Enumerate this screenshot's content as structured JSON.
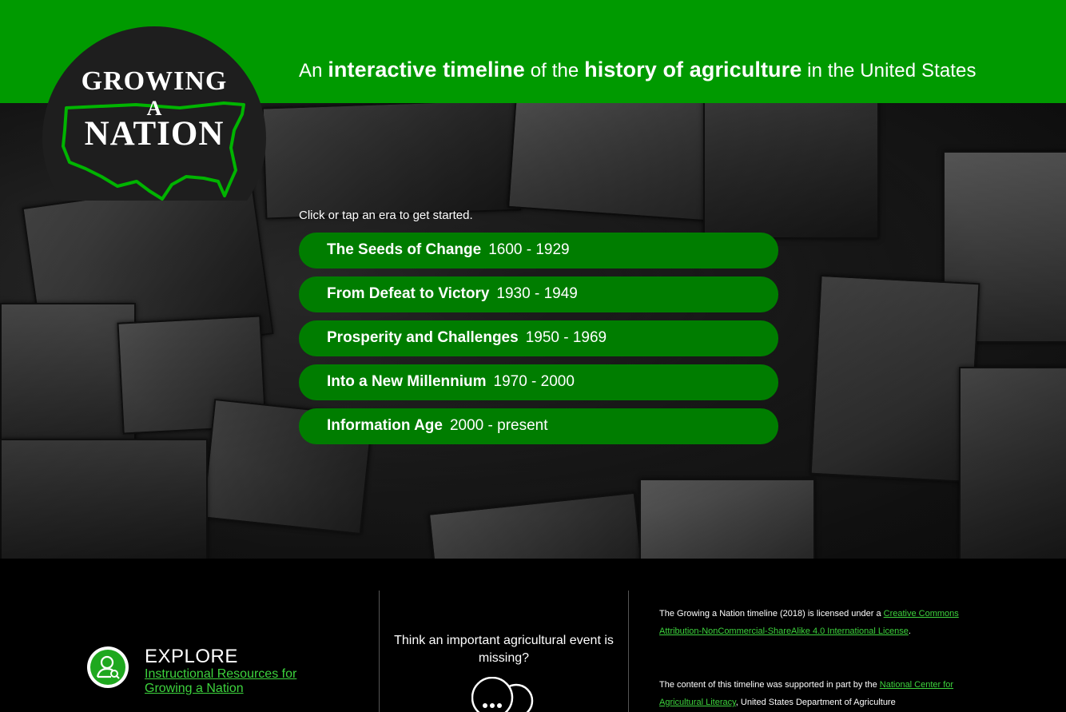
{
  "logo": {
    "line1": "GROWING",
    "line2": "A",
    "line3": "NATION"
  },
  "header": {
    "tagline_part1": "An ",
    "tagline_strong1": "interactive timeline",
    "tagline_part2": " of the ",
    "tagline_strong2": "history of agriculture",
    "tagline_part3": " in the United States"
  },
  "main": {
    "prompt": "Click or tap an era to get started.",
    "eras": [
      {
        "name": "The Seeds of Change",
        "years": "1600 - 1929"
      },
      {
        "name": "From Defeat to Victory",
        "years": "1930 - 1949"
      },
      {
        "name": "Prosperity and Challenges",
        "years": "1950 - 1969"
      },
      {
        "name": "Into a New Millennium",
        "years": "1970 - 2000"
      },
      {
        "name": "Information Age",
        "years": "2000 - present"
      }
    ]
  },
  "footer": {
    "explore_title": "EXPLORE",
    "explore_link": "Instructional Resources for Growing a Nation",
    "missing_text": "Think an important agricultural event is missing?",
    "license_prefix": "The Growing a Nation timeline (2018) is licensed under a ",
    "license_link": "Creative Commons Attribution-NonCommercial-ShareAlike 4.0 International License",
    "license_suffix": ".",
    "support_prefix": "The content of this timeline was supported in part by the ",
    "support_link": "National Center for Agricultural Literacy",
    "support_suffix": ", United States Department of Agriculture"
  },
  "colors": {
    "header_green": "#009a00",
    "era_button": "#007d00",
    "link_green": "#3dd33d",
    "explore_icon_green": "#1fa81f"
  },
  "icons": {
    "explore": "user-search-icon",
    "missing": "chat-bubbles-icon"
  }
}
